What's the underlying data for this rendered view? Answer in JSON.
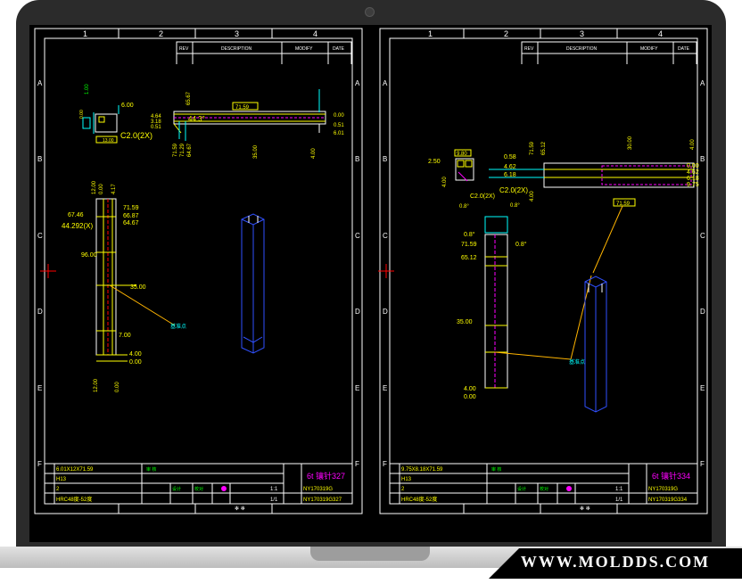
{
  "brand": {
    "url": "WWW.MOLDDS.COM"
  },
  "colors": {
    "frame": "#ffffff",
    "cyan": "#00ffff",
    "yellow": "#ffff00",
    "green": "#00ff00",
    "magenta": "#ff00ff",
    "red": "#ff0000",
    "orange": "#ffb400",
    "blue": "#3050ff"
  },
  "drawing_left": {
    "zone_numbers": [
      "1",
      "2",
      "3",
      "4"
    ],
    "zone_letters": [
      "A",
      "B",
      "C",
      "D",
      "E",
      "F"
    ],
    "revision_headers": [
      "REV",
      "DESCRIPTION",
      "MODIFY",
      "DATE"
    ],
    "dims_top": {
      "d1": "6.00",
      "d2": "1.00",
      "d3": "4.64",
      "d4": "3.18",
      "d5": "0.51",
      "d6": "C2.0(2X)",
      "d7": "65.67",
      "d8": "71.59",
      "d9": "44.3°",
      "d10": "71.29",
      "d11": "64.67",
      "d12": "35.00",
      "d13": "4.00",
      "d14": "0.00",
      "d15": "0.51",
      "d16": "6.01",
      "top_box": "71.59",
      "bot_box": "13.00"
    },
    "dims_front": {
      "f1": "12.00",
      "f2": "0.00",
      "f3": "4.17",
      "f4": "67.46",
      "f5": "44.292(X)",
      "f6": "71.59",
      "f7": "66.87",
      "f8": "64.67",
      "f9": "96.00",
      "f10": "35.00",
      "f11": "7.00",
      "f12": "4.00",
      "f13": "0.00",
      "f14": "12.00",
      "f15": "0.00"
    },
    "datum_label": "基准点",
    "title_block": {
      "size": "6.01X12X71.59",
      "material": "H13",
      "qty": "2",
      "heat": "HRC48度-52度",
      "scale": "1:1",
      "sheet": "1/1",
      "part_no": "6t 镶针327",
      "drawing_no": "NY170319G",
      "file_no": "NY170319G327",
      "rev": "A"
    }
  },
  "drawing_right": {
    "zone_numbers": [
      "1",
      "2",
      "3",
      "4"
    ],
    "zone_letters": [
      "A",
      "B",
      "C",
      "D",
      "E",
      "F"
    ],
    "revision_headers": [
      "REV",
      "DESCRIPTION",
      "MODIFY",
      "DATE"
    ],
    "dims_top": {
      "r1": "2.50",
      "r2": "9.80",
      "r3": "0.58",
      "r4": "4.62",
      "r5": "6.18",
      "r6": "C2.0(2X)",
      "r7": "71.59",
      "r8": "65.12",
      "r9": "30.00",
      "r10": "4.00",
      "r11": "0.00",
      "r12": "4.62",
      "r13": "6.18",
      "r14": "9.75",
      "r15": "0.8°",
      "r16": "4.00",
      "box": "71.59"
    },
    "dims_front": {
      "q1": "0.8°",
      "q2": "71.59",
      "q3": "65.12",
      "q4": "35.00",
      "q5": "4.00",
      "q6": "0.00",
      "q7": "0.8°"
    },
    "datum_label": "基准点",
    "title_block": {
      "size": "9.75X8.18X71.59",
      "material": "H13",
      "qty": "2",
      "heat": "HRC48度-52度",
      "scale": "1:1",
      "sheet": "1/1",
      "part_no": "6t 镶针334",
      "drawing_no": "NY170319G",
      "file_no": "NY170319G334",
      "rev": "A"
    }
  }
}
